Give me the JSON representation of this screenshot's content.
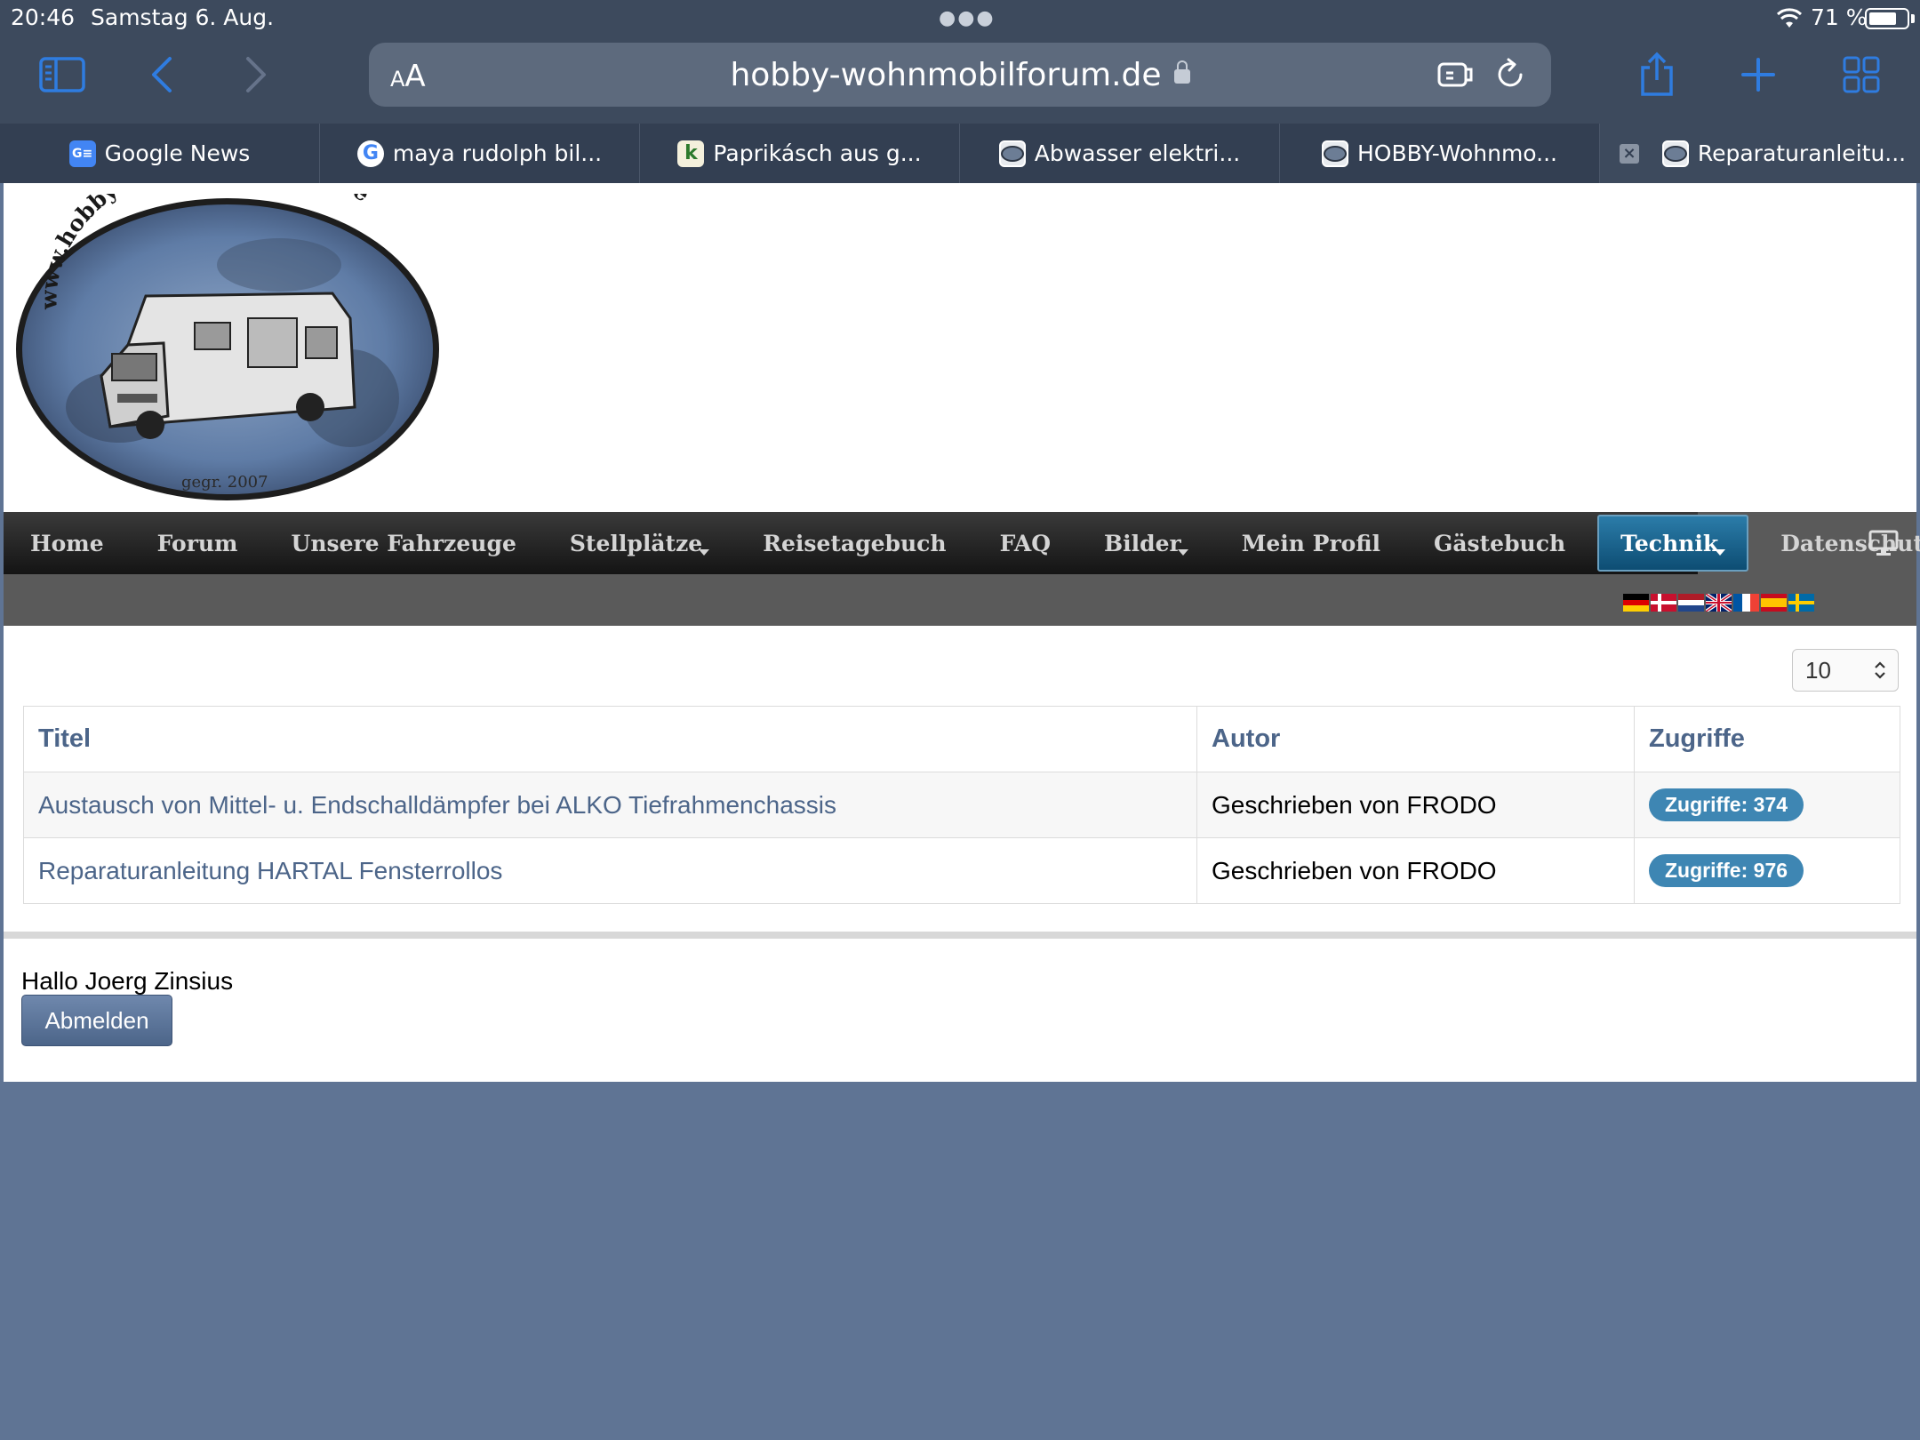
{
  "status_bar": {
    "time": "20:46",
    "date": "Samstag 6. Aug.",
    "battery": "71 %",
    "battery_level": 0.71
  },
  "browser": {
    "reader_label_small": "A",
    "reader_label_large": "A",
    "url": "hobby-wohnmobilforum.de",
    "tabs": [
      {
        "label": "Google News",
        "icon": "google-news-icon"
      },
      {
        "label": "maya rudolph bil...",
        "icon": "google-icon"
      },
      {
        "label": "Paprikásch aus g...",
        "icon": "chefkoch-icon"
      },
      {
        "label": "Abwasser elektri...",
        "icon": "hobby-forum-icon"
      },
      {
        "label": "HOBBY-Wohnmo...",
        "icon": "hobby-forum-icon"
      },
      {
        "label": "Reparaturanleitu...",
        "icon": "hobby-forum-icon"
      }
    ]
  },
  "logo": {
    "arc_text": "www.hobby-wohnmobilforum.de",
    "founded": "gegr. 2007"
  },
  "nav": {
    "items": [
      {
        "label": "Home"
      },
      {
        "label": "Forum"
      },
      {
        "label": "Unsere Fahrzeuge"
      },
      {
        "label": "Stellplätze"
      },
      {
        "label": "Reisetagebuch"
      },
      {
        "label": "FAQ"
      },
      {
        "label": "Bilder"
      },
      {
        "label": "Mein Profil"
      },
      {
        "label": "Gästebuch"
      },
      {
        "label": "Technik"
      },
      {
        "label": "Datenschutz"
      }
    ],
    "active": "Technik",
    "flags": [
      "de",
      "dk",
      "nl",
      "gb",
      "fr",
      "es",
      "se"
    ]
  },
  "list": {
    "page_size": "10",
    "headers": {
      "title": "Titel",
      "author": "Autor",
      "hits": "Zugriffe"
    },
    "rows": [
      {
        "title": "Austausch von Mittel- u. Endschalldämpfer bei ALKO Tiefrahmenchassis",
        "author": "Geschrieben von FRODO",
        "hits": "Zugriffe: 374"
      },
      {
        "title": "Reparaturanleitung HARTAL Fensterrollos",
        "author": "Geschrieben von FRODO",
        "hits": "Zugriffe: 976"
      }
    ]
  },
  "user": {
    "greeting": "Hallo Joerg Zinsius",
    "logout_label": "Abmelden"
  },
  "colors": {
    "chrome_bg": "#3d4a5d",
    "link": "#4c6589",
    "badge": "#3e86b3",
    "active_nav": "#1a6592",
    "desktop_bg": "#5f7494"
  }
}
